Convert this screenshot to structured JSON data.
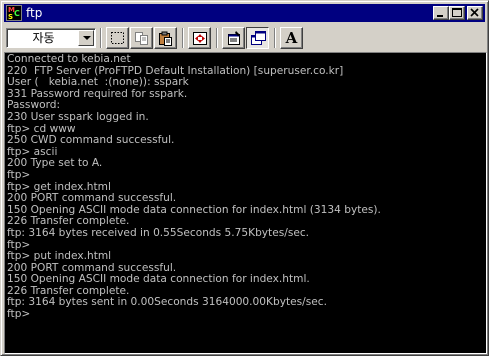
{
  "window": {
    "title": "ftp"
  },
  "toolbar": {
    "encoding_value": "자동"
  },
  "terminal": {
    "lines": [
      "Connected to kebia.net",
      "220  FTP Server (ProFTPD Default Installation) [superuser.co.kr]",
      "User (   kebia.net  :(none)): sspark",
      "331 Password required for sspark.",
      "Password:",
      "230 User sspark logged in.",
      "ftp> cd www",
      "250 CWD command successful.",
      "ftp> ascii",
      "200 Type set to A.",
      "ftp>",
      "ftp> get index.html",
      "200 PORT command successful.",
      "150 Opening ASCII mode data connection for index.html (3134 bytes).",
      "226 Transfer complete.",
      "ftp: 3164 bytes received in 0.55Seconds 5.75Kbytes/sec.",
      "ftp>",
      "ftp> put index.html",
      "200 PORT command successful.",
      "150 Opening ASCII mode data connection for index.html.",
      "226 Transfer complete.",
      "ftp: 3164 bytes sent in 0.00Seconds 3164000.00Kbytes/sec.",
      "ftp>"
    ]
  },
  "colors": {
    "title_bar": "#000080",
    "terminal_bg": "#000000",
    "terminal_fg": "#c0c0c0",
    "chrome": "#d4d0c8"
  }
}
